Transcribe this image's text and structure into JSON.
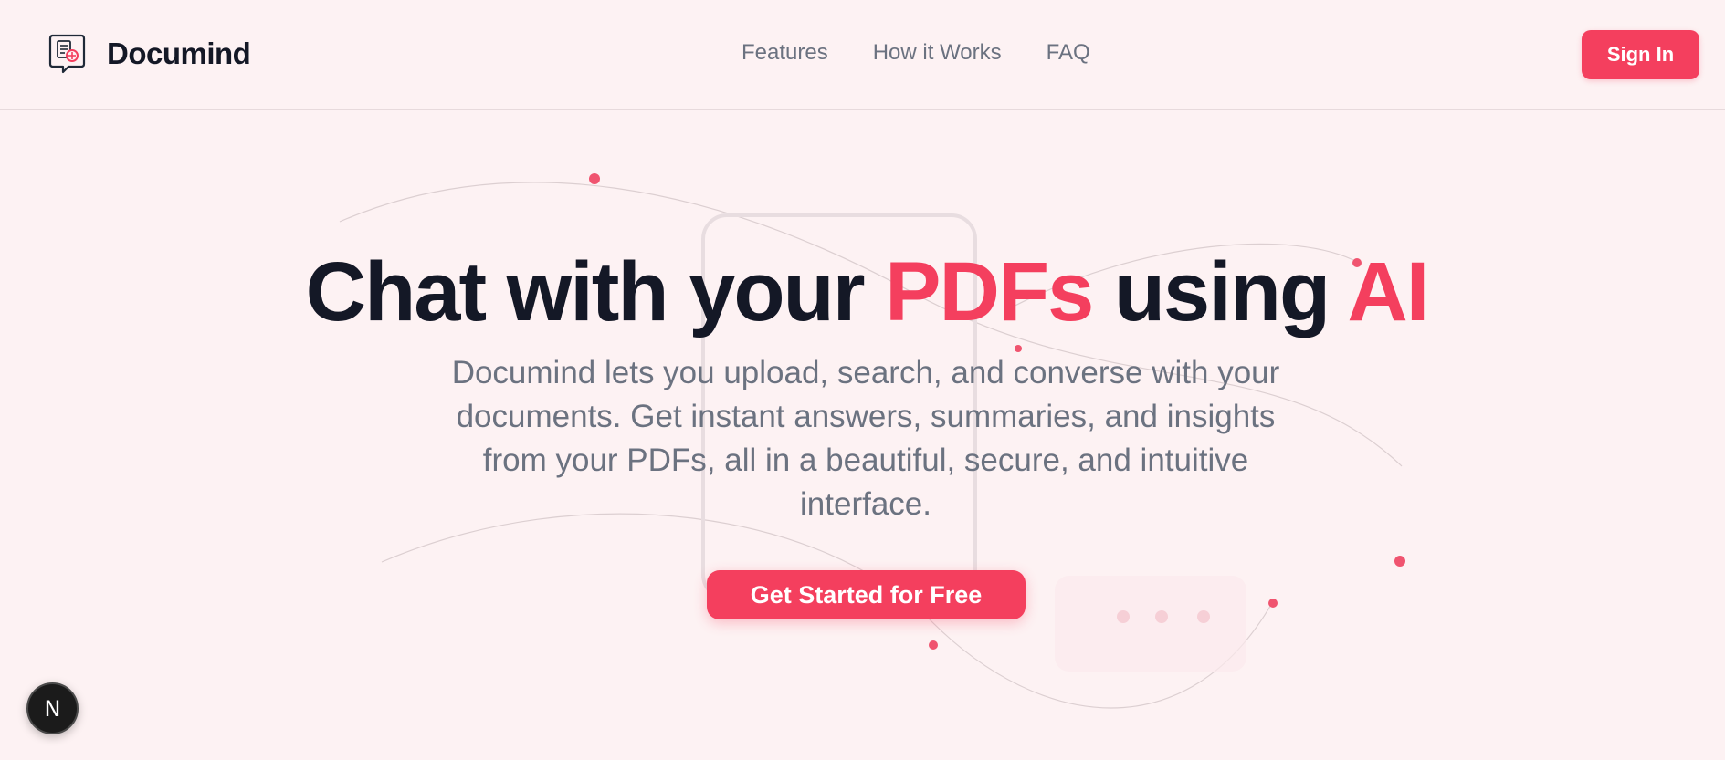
{
  "header": {
    "brand_name": "Documind",
    "nav": [
      "Features",
      "How it Works",
      "FAQ"
    ],
    "signin_label": "Sign In"
  },
  "hero": {
    "title_part1": "Chat with your ",
    "title_accent1": "PDFs",
    "title_part2": " using ",
    "title_accent2": "AI",
    "subtitle": "Documind lets you upload, search, and converse with your documents. Get instant answers, summaries, and insights from your PDFs, all in a beautiful, secure, and intuitive interface.",
    "cta_label": "Get Started for Free"
  },
  "dev_badge": {
    "letter": "N"
  },
  "icons": {
    "brand": "document-chat-icon",
    "badge": "nextjs-icon"
  },
  "colors": {
    "accent": "#f43f5e",
    "background": "#fdf2f3",
    "text": "#141826",
    "muted": "#6b7280"
  }
}
